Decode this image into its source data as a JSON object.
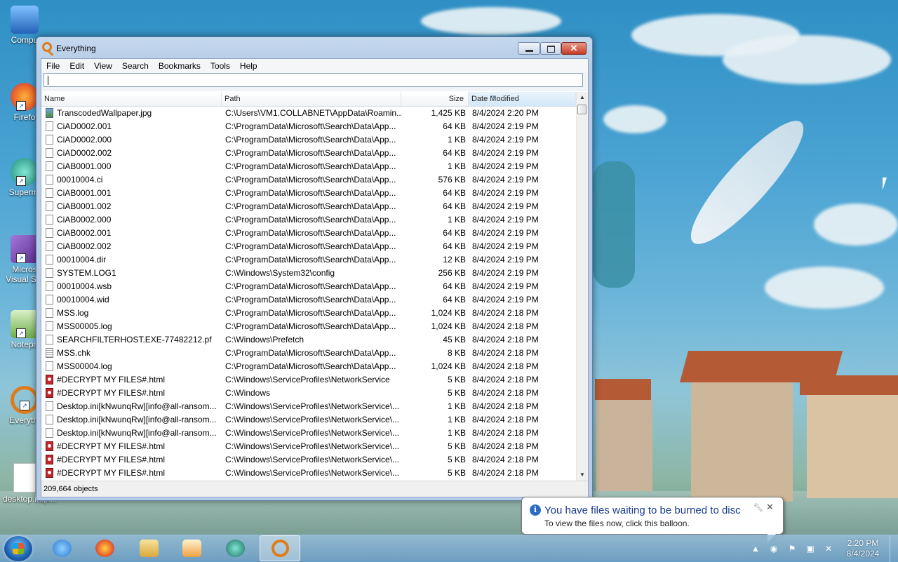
{
  "desktop": {
    "icons": [
      {
        "label": "Compu",
        "icon": "computer-icon"
      },
      {
        "label": "Firefo",
        "icon": "firefox-icon"
      },
      {
        "label": "Supermi",
        "icon": "supermium-icon"
      },
      {
        "label": "Micros Visual Stu",
        "icon": "visual-studio-icon"
      },
      {
        "label": "Notepa",
        "icon": "notepad-icon"
      },
      {
        "label": "Everythi",
        "icon": "everything-icon"
      },
      {
        "label": "desktop.ini(k...",
        "icon": "file-icon"
      }
    ]
  },
  "window": {
    "title": "Everything",
    "menu": [
      "File",
      "Edit",
      "View",
      "Search",
      "Bookmarks",
      "Tools",
      "Help"
    ],
    "search": {
      "value": "",
      "placeholder": ""
    },
    "columns": {
      "name": "Name",
      "path": "Path",
      "size": "Size",
      "date": "Date Modified"
    },
    "sort_column": "Date Modified",
    "rows": [
      {
        "icon": "img",
        "name": "TranscodedWallpaper.jpg",
        "path": "C:\\Users\\VM1.COLLABNET\\AppData\\Roamin...",
        "size": "1,425 KB",
        "date": "8/4/2024 2:20 PM"
      },
      {
        "icon": "file",
        "name": "CiAD0002.001",
        "path": "C:\\ProgramData\\Microsoft\\Search\\Data\\App...",
        "size": "64 KB",
        "date": "8/4/2024 2:19 PM"
      },
      {
        "icon": "file",
        "name": "CiAD0002.000",
        "path": "C:\\ProgramData\\Microsoft\\Search\\Data\\App...",
        "size": "1 KB",
        "date": "8/4/2024 2:19 PM"
      },
      {
        "icon": "file",
        "name": "CiAD0002.002",
        "path": "C:\\ProgramData\\Microsoft\\Search\\Data\\App...",
        "size": "64 KB",
        "date": "8/4/2024 2:19 PM"
      },
      {
        "icon": "file",
        "name": "CiAB0001.000",
        "path": "C:\\ProgramData\\Microsoft\\Search\\Data\\App...",
        "size": "1 KB",
        "date": "8/4/2024 2:19 PM"
      },
      {
        "icon": "file",
        "name": "00010004.ci",
        "path": "C:\\ProgramData\\Microsoft\\Search\\Data\\App...",
        "size": "576 KB",
        "date": "8/4/2024 2:19 PM"
      },
      {
        "icon": "file",
        "name": "CiAB0001.001",
        "path": "C:\\ProgramData\\Microsoft\\Search\\Data\\App...",
        "size": "64 KB",
        "date": "8/4/2024 2:19 PM"
      },
      {
        "icon": "file",
        "name": "CiAB0001.002",
        "path": "C:\\ProgramData\\Microsoft\\Search\\Data\\App...",
        "size": "64 KB",
        "date": "8/4/2024 2:19 PM"
      },
      {
        "icon": "file",
        "name": "CiAB0002.000",
        "path": "C:\\ProgramData\\Microsoft\\Search\\Data\\App...",
        "size": "1 KB",
        "date": "8/4/2024 2:19 PM"
      },
      {
        "icon": "file",
        "name": "CiAB0002.001",
        "path": "C:\\ProgramData\\Microsoft\\Search\\Data\\App...",
        "size": "64 KB",
        "date": "8/4/2024 2:19 PM"
      },
      {
        "icon": "file",
        "name": "CiAB0002.002",
        "path": "C:\\ProgramData\\Microsoft\\Search\\Data\\App...",
        "size": "64 KB",
        "date": "8/4/2024 2:19 PM"
      },
      {
        "icon": "file",
        "name": "00010004.dir",
        "path": "C:\\ProgramData\\Microsoft\\Search\\Data\\App...",
        "size": "12 KB",
        "date": "8/4/2024 2:19 PM"
      },
      {
        "icon": "file",
        "name": "SYSTEM.LOG1",
        "path": "C:\\Windows\\System32\\config",
        "size": "256 KB",
        "date": "8/4/2024 2:19 PM"
      },
      {
        "icon": "file",
        "name": "00010004.wsb",
        "path": "C:\\ProgramData\\Microsoft\\Search\\Data\\App...",
        "size": "64 KB",
        "date": "8/4/2024 2:19 PM"
      },
      {
        "icon": "file",
        "name": "00010004.wid",
        "path": "C:\\ProgramData\\Microsoft\\Search\\Data\\App...",
        "size": "64 KB",
        "date": "8/4/2024 2:19 PM"
      },
      {
        "icon": "file",
        "name": "MSS.log",
        "path": "C:\\ProgramData\\Microsoft\\Search\\Data\\App...",
        "size": "1,024 KB",
        "date": "8/4/2024 2:18 PM"
      },
      {
        "icon": "file",
        "name": "MSS00005.log",
        "path": "C:\\ProgramData\\Microsoft\\Search\\Data\\App...",
        "size": "1,024 KB",
        "date": "8/4/2024 2:18 PM"
      },
      {
        "icon": "file",
        "name": "SEARCHFILTERHOST.EXE-77482212.pf",
        "path": "C:\\Windows\\Prefetch",
        "size": "45 KB",
        "date": "8/4/2024 2:18 PM"
      },
      {
        "icon": "cfg",
        "name": "MSS.chk",
        "path": "C:\\ProgramData\\Microsoft\\Search\\Data\\App...",
        "size": "8 KB",
        "date": "8/4/2024 2:18 PM"
      },
      {
        "icon": "file",
        "name": "MSS00004.log",
        "path": "C:\\ProgramData\\Microsoft\\Search\\Data\\App...",
        "size": "1,024 KB",
        "date": "8/4/2024 2:18 PM"
      },
      {
        "icon": "html",
        "name": "#DECRYPT MY FILES#.html",
        "path": "C:\\Windows\\ServiceProfiles\\NetworkService",
        "size": "5 KB",
        "date": "8/4/2024 2:18 PM"
      },
      {
        "icon": "html",
        "name": "#DECRYPT MY FILES#.html",
        "path": "C:\\Windows",
        "size": "5 KB",
        "date": "8/4/2024 2:18 PM"
      },
      {
        "icon": "file",
        "name": "Desktop.ini[kNwunqRw][info@all-ransom...",
        "path": "C:\\Windows\\ServiceProfiles\\NetworkService\\...",
        "size": "1 KB",
        "date": "8/4/2024 2:18 PM"
      },
      {
        "icon": "file",
        "name": "Desktop.ini[kNwunqRw][info@all-ransom...",
        "path": "C:\\Windows\\ServiceProfiles\\NetworkService\\...",
        "size": "1 KB",
        "date": "8/4/2024 2:18 PM"
      },
      {
        "icon": "file",
        "name": "Desktop.ini[kNwunqRw][info@all-ransom...",
        "path": "C:\\Windows\\ServiceProfiles\\NetworkService\\...",
        "size": "1 KB",
        "date": "8/4/2024 2:18 PM"
      },
      {
        "icon": "html",
        "name": "#DECRYPT MY FILES#.html",
        "path": "C:\\Windows\\ServiceProfiles\\NetworkService\\...",
        "size": "5 KB",
        "date": "8/4/2024 2:18 PM"
      },
      {
        "icon": "html",
        "name": "#DECRYPT MY FILES#.html",
        "path": "C:\\Windows\\ServiceProfiles\\NetworkService\\...",
        "size": "5 KB",
        "date": "8/4/2024 2:18 PM"
      },
      {
        "icon": "html",
        "name": "#DECRYPT MY FILES#.html",
        "path": "C:\\Windows\\ServiceProfiles\\NetworkService\\...",
        "size": "5 KB",
        "date": "8/4/2024 2:18 PM"
      }
    ],
    "status": "209,664 objects"
  },
  "balloon": {
    "title": "You have files waiting to be burned to disc",
    "text": "To view the files now, click this balloon."
  },
  "taskbar": {
    "apps": [
      {
        "name": "ie-icon",
        "color": "#2a7ad2"
      },
      {
        "name": "firefox-icon",
        "color": "#e8602a"
      },
      {
        "name": "explorer-icon",
        "color": "#e9c15a"
      },
      {
        "name": "media-player-icon",
        "color": "#f0a040"
      },
      {
        "name": "supermium-icon",
        "color": "#2a9b8a"
      },
      {
        "name": "everything-icon",
        "color": "#e07b1a"
      }
    ],
    "clock": {
      "time": "2:20 PM",
      "date": "8/4/2024"
    }
  },
  "colors": {
    "accent": "#1a3d8f",
    "ransom_icon": "#c0282d",
    "sorted_header": "#d3e8f8"
  }
}
